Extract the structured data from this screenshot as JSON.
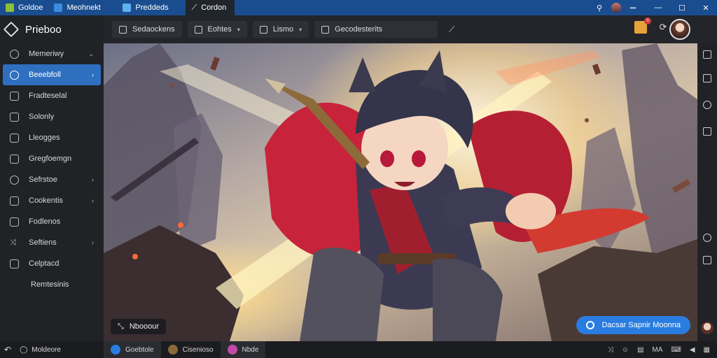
{
  "window": {
    "tabs": [
      {
        "label": "Goldoe",
        "color": "#8fbe3a"
      },
      {
        "label": "Meohnekt",
        "color": "#3a8de0"
      },
      {
        "label": "Preddeds",
        "color": "#5fb0f0"
      },
      {
        "label": "Cordon",
        "color": "#cccccc"
      }
    ],
    "controls": {
      "minimize": "—",
      "maximize": "☐",
      "close": "✕",
      "pin": "⚲",
      "more": "•••"
    }
  },
  "sidebar": {
    "brand": "Prieboo",
    "items": [
      {
        "label": "Memeriwy",
        "chevron": "⌄"
      },
      {
        "label": "Beeebfoll",
        "chevron": "›",
        "active": true
      },
      {
        "label": "Fradteselal"
      },
      {
        "label": "Solonly"
      },
      {
        "label": "Lleogges"
      },
      {
        "label": "Gregfoemgn"
      },
      {
        "label": "Sefrstoe",
        "chevron": "›"
      },
      {
        "label": "Cookentis",
        "chevron": "›"
      },
      {
        "label": "Fodlenos"
      },
      {
        "label": "Seftiens",
        "chevron": "›"
      },
      {
        "label": "Celptacd"
      },
      {
        "label": "Remtesinis"
      }
    ]
  },
  "toolbar": {
    "buttons": [
      {
        "label": "Sedaockens"
      },
      {
        "label": "Eohtes"
      },
      {
        "label": "Lismo"
      }
    ],
    "search_label": "Gecodesterits",
    "badge_count": "0"
  },
  "canvas": {
    "chip_label": "Nbooour",
    "cta_label": "Dacsar Sapnir Moonna"
  },
  "bottombar": {
    "left_label": "Moldeore",
    "items": [
      {
        "label": "Goebtole",
        "color": "#2a7de0"
      },
      {
        "label": "Cisenioso",
        "color": "#8a6a3a"
      },
      {
        "label": "Nbde",
        "color": "#c24aa8"
      }
    ],
    "status": "MA"
  }
}
